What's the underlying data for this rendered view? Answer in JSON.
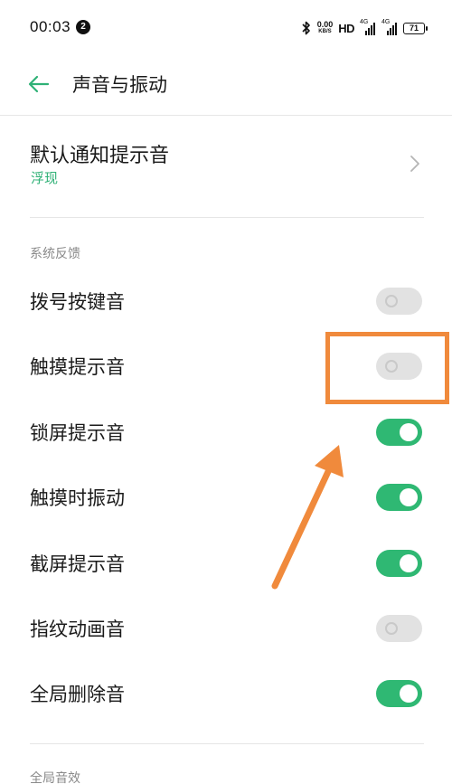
{
  "status_bar": {
    "time": "00:03",
    "notification_count": "2",
    "net_speed_value": "0.00",
    "net_speed_unit": "KB/S",
    "hd_label": "HD",
    "signal_1_label": "4G",
    "signal_2_label": "4G",
    "battery_level": "71"
  },
  "header": {
    "title": "声音与振动",
    "back_icon": "arrow-left-icon"
  },
  "default_notification": {
    "title": "默认通知提示音",
    "value": "浮现",
    "chevron_icon": "chevron-right-icon"
  },
  "section_system_feedback": {
    "label": "系统反馈",
    "items": [
      {
        "label": "拨号按键音",
        "enabled": false
      },
      {
        "label": "触摸提示音",
        "enabled": false
      },
      {
        "label": "锁屏提示音",
        "enabled": true
      },
      {
        "label": "触摸时振动",
        "enabled": true
      },
      {
        "label": "截屏提示音",
        "enabled": true
      },
      {
        "label": "指纹动画音",
        "enabled": false
      },
      {
        "label": "全局删除音",
        "enabled": true
      }
    ]
  },
  "section_global_effects": {
    "label": "全局音效"
  },
  "colors": {
    "accent": "#2fb873",
    "accent_text": "#2fb176",
    "toggle_off": "#e2e2e2",
    "annotation": "#f08a3c"
  }
}
